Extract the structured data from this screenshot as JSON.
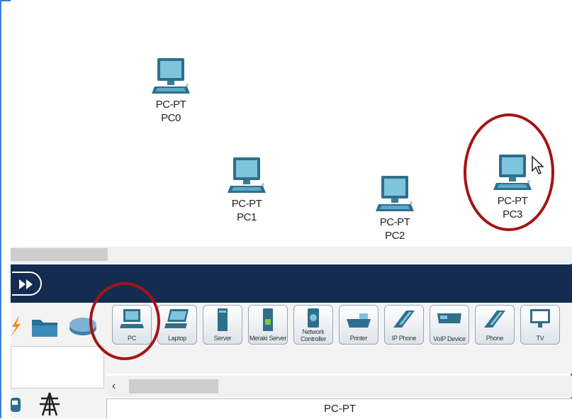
{
  "workspace": {
    "devices": [
      {
        "type": "PC-PT",
        "name": "PC0"
      },
      {
        "type": "PC-PT",
        "name": "PC1"
      },
      {
        "type": "PC-PT",
        "name": "PC2"
      },
      {
        "type": "PC-PT",
        "name": "PC3"
      }
    ]
  },
  "toolbar": {
    "icon": "fast-forward-icon"
  },
  "left_panel": {
    "icons": [
      "lightning-icon",
      "folder-icon",
      "router-icon",
      "cloud-icon",
      "tower-icon"
    ]
  },
  "device_bar": {
    "items": [
      {
        "label": "PC"
      },
      {
        "label": "Laptop"
      },
      {
        "label": "Server"
      },
      {
        "label": "Meraki Server"
      },
      {
        "label": "Network Controller"
      },
      {
        "label": "Printer"
      },
      {
        "label": "IP Phone"
      },
      {
        "label": "VoIP Device"
      },
      {
        "label": "Phone"
      },
      {
        "label": "TV"
      }
    ]
  },
  "scroll": {
    "left_arrow": "‹"
  },
  "status": {
    "selected_model": "PC-PT"
  },
  "colors": {
    "highlight": "#a31515",
    "navbar": "#132c4f",
    "frame": "#3b7fd0"
  }
}
